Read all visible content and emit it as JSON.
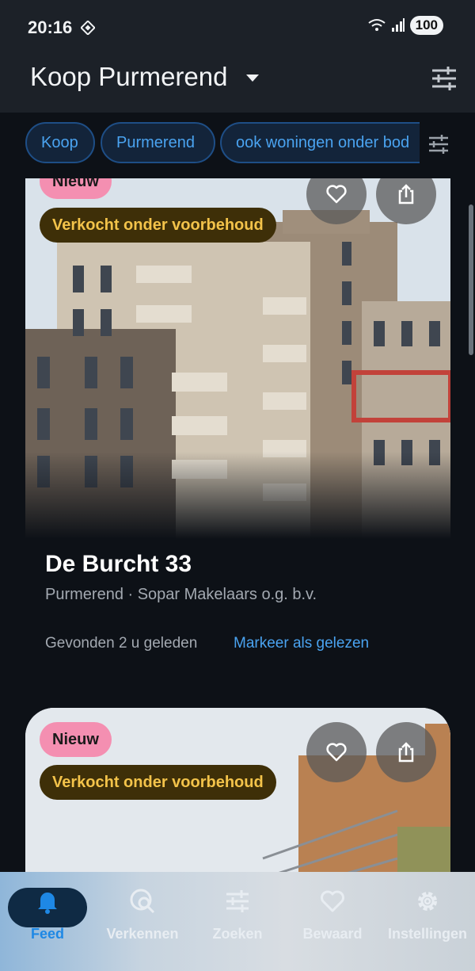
{
  "status_bar": {
    "time": "20:16",
    "battery": "100"
  },
  "app_bar": {
    "title": "Koop Purmerend"
  },
  "filters": {
    "chips": [
      "Koop",
      "Purmerend",
      "ook woningen onder bod"
    ]
  },
  "listings": [
    {
      "badge_new": "Nieuw",
      "badge_status": "Verkocht onder voorbehoud",
      "title": "De Burcht 33",
      "subtitle": "Purmerend · Sopar Makelaars o.g. b.v.",
      "found": "Gevonden 2 u geleden",
      "mark_read": "Markeer als gelezen"
    },
    {
      "badge_new": "Nieuw",
      "badge_status": "Verkocht onder voorbehoud"
    }
  ],
  "bottom_nav": [
    {
      "label": "Feed",
      "icon": "bell-icon",
      "active": true
    },
    {
      "label": "Verkennen",
      "icon": "explore-search-icon"
    },
    {
      "label": "Zoeken",
      "icon": "sliders-icon"
    },
    {
      "label": "Bewaard",
      "icon": "heart-icon"
    },
    {
      "label": "Instellingen",
      "icon": "gear-icon"
    }
  ],
  "colors": {
    "accent": "#4aa3f0",
    "badge_new": "#f48fb1",
    "badge_status_bg": "#3e2f08",
    "badge_status_text": "#f3c34a",
    "background": "#0d1117"
  }
}
